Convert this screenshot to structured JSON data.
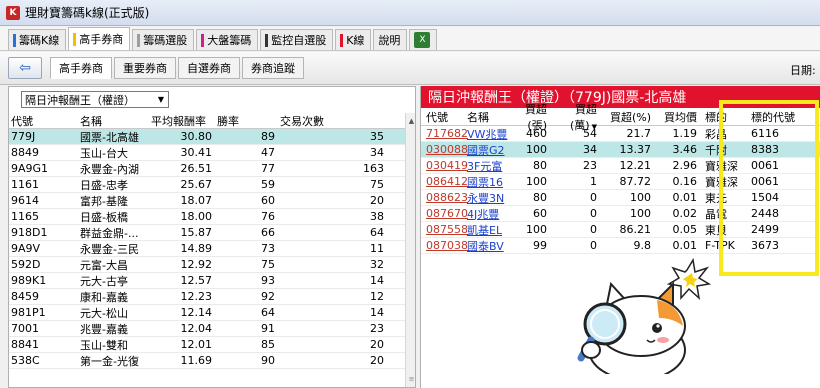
{
  "window": {
    "title": "理財寶籌碼k線(正式版)"
  },
  "menu_tabs": [
    {
      "label": "籌碼K線",
      "color": "#2b6fd6"
    },
    {
      "label": "高手券商",
      "color": "#f0c000"
    },
    {
      "label": "籌碼選股",
      "color": "#9e9e9e"
    },
    {
      "label": "大盤籌碼",
      "color": "#d81b8c"
    },
    {
      "label": "監控自選股",
      "color": "#333333"
    },
    {
      "label": "K線",
      "color": "#e1122d"
    },
    {
      "label": "說明",
      "color": ""
    }
  ],
  "sub_tabs": [
    "高手券商",
    "重要券商",
    "自選券商",
    "券商追蹤"
  ],
  "date_label": "日期:",
  "filter": {
    "selected": "隔日沖報酬王（權證）"
  },
  "left_table": {
    "headers": [
      "代號",
      "名稱",
      "平均報酬率",
      "勝率",
      "交易次數"
    ],
    "rows": [
      [
        "779J",
        "國票-北高雄",
        "30.80",
        "89",
        "35"
      ],
      [
        "8849",
        "玉山-台大",
        "30.41",
        "47",
        "34"
      ],
      [
        "9A9G1",
        "永豐金-內湖",
        "26.51",
        "77",
        "163"
      ],
      [
        "1161",
        "日盛-忠孝",
        "25.67",
        "59",
        "75"
      ],
      [
        "9614",
        "富邦-基隆",
        "18.07",
        "60",
        "20"
      ],
      [
        "1165",
        "日盛-板橋",
        "18.00",
        "76",
        "38"
      ],
      [
        "918D1",
        "群益金鼎-...",
        "15.87",
        "66",
        "64"
      ],
      [
        "9A9V",
        "永豐金-三民",
        "14.89",
        "73",
        "11"
      ],
      [
        "592D",
        "元富-大昌",
        "12.92",
        "75",
        "32"
      ],
      [
        "989K1",
        "元大-古亭",
        "12.57",
        "93",
        "14"
      ],
      [
        "8459",
        "康和-嘉義",
        "12.23",
        "92",
        "12"
      ],
      [
        "981P1",
        "元大-松山",
        "12.14",
        "64",
        "14"
      ],
      [
        "7001",
        "兆豐-嘉義",
        "12.04",
        "91",
        "23"
      ],
      [
        "8841",
        "玉山-雙和",
        "12.01",
        "85",
        "20"
      ],
      [
        "538C",
        "第一金-光復",
        "11.69",
        "90",
        "20"
      ]
    ]
  },
  "right_panel": {
    "title": "隔日沖報酬王（權證）（779J)國票-北高雄",
    "headers": [
      "代號",
      "名稱",
      "買超(張)",
      "買超(萬)",
      "買超(%)",
      "買均價",
      "標的",
      "標的代號"
    ],
    "sort_indicator": "▼",
    "rows": [
      [
        "717682",
        "VW兆豐",
        "460",
        "54",
        "21.7",
        "1.19",
        "彩晶",
        "6116"
      ],
      [
        "030088",
        "國票G2",
        "100",
        "34",
        "13.37",
        "3.46",
        "千附",
        "8383"
      ],
      [
        "030419",
        "3F元富",
        "80",
        "23",
        "12.21",
        "2.96",
        "寶雅深",
        "0061"
      ],
      [
        "086412",
        "國票16",
        "100",
        "1",
        "87.72",
        "0.16",
        "寶雅深",
        "0061"
      ],
      [
        "088623",
        "永豐3N",
        "80",
        "0",
        "100",
        "0.01",
        "東元",
        "1504"
      ],
      [
        "087670",
        "4J兆豐",
        "60",
        "0",
        "100",
        "0.02",
        "晶電",
        "2448"
      ],
      [
        "087558",
        "凱基EL",
        "100",
        "0",
        "86.21",
        "0.05",
        "東貝",
        "2499"
      ],
      [
        "087038",
        "國泰BV",
        "99",
        "0",
        "9.8",
        "0.01",
        "F-TPK",
        "3673"
      ]
    ]
  },
  "colors": {
    "accent_red": "#e1122d",
    "highlight_yellow": "#f7ea1c",
    "selected_row": "#bde7e6"
  }
}
